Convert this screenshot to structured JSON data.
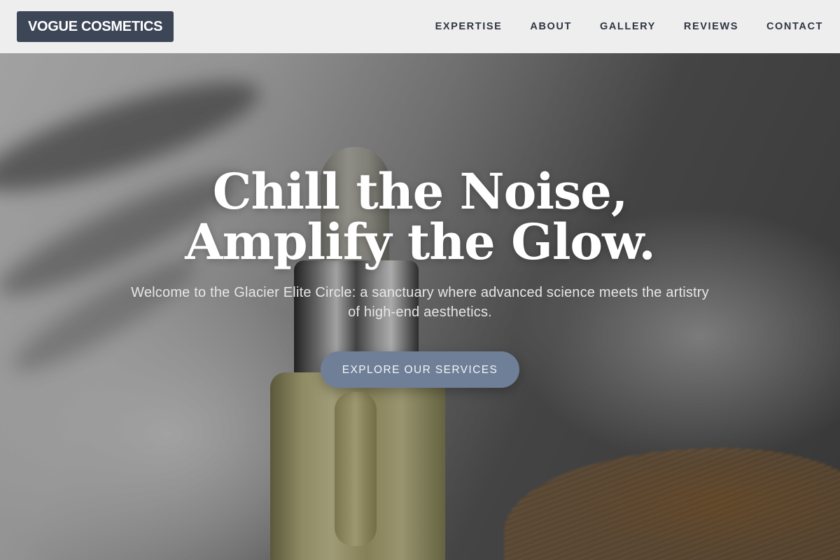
{
  "brand": {
    "name": "VOGUE COSMETICS",
    "background_color": "#3d4657"
  },
  "nav": {
    "items": [
      {
        "label": "EXPERTISE"
      },
      {
        "label": "ABOUT"
      },
      {
        "label": "GALLERY"
      },
      {
        "label": "REVIEWS"
      },
      {
        "label": "CONTACT"
      }
    ]
  },
  "hero": {
    "title_line1": "Chill the Noise,",
    "title_line2": "Amplify the Glow.",
    "subtitle": "Welcome to the Glacier Elite Circle: a sanctuary where advanced science meets the artistry of high-end aesthetics.",
    "cta_label": "EXPLORE OUR SERVICES",
    "cta_color": "#6f7f98",
    "background_image": "serum-dropper-bottle-photo"
  }
}
